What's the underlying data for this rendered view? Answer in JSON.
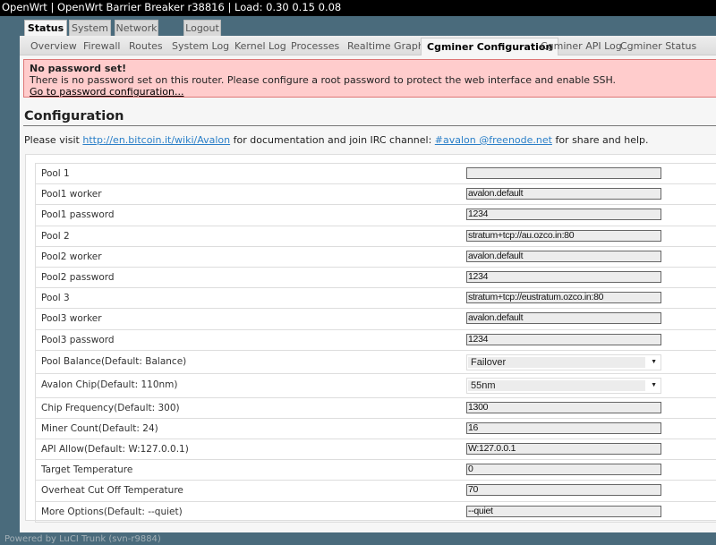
{
  "header": {
    "title": "OpenWrt | OpenWrt Barrier Breaker r38816 | Load: 0.30 0.15 0.08"
  },
  "main_tabs": [
    {
      "label": "Status",
      "active": true
    },
    {
      "label": "System"
    },
    {
      "label": "Network"
    },
    {
      "label": "Logout"
    }
  ],
  "sub_tabs": [
    {
      "label": "Overview"
    },
    {
      "label": "Firewall"
    },
    {
      "label": "Routes"
    },
    {
      "label": "System Log"
    },
    {
      "label": "Kernel Log"
    },
    {
      "label": "Processes"
    },
    {
      "label": "Realtime Graphs"
    },
    {
      "label": "Cgminer Configuration",
      "active": true
    },
    {
      "label": "Cgminer API Log"
    },
    {
      "label": "Cgminer Status"
    }
  ],
  "alert": {
    "title": "No password set!",
    "text": "There is no password set on this router. Please configure a root password to protect the web interface and enable SSH.",
    "link": "Go to password configuration...",
    "color": "#ffcccc"
  },
  "config": {
    "title": "Configuration",
    "intro_pre": "Please visit ",
    "intro_link": "http://en.bitcoin.it/wiki/Avalon",
    "intro_mid": " for documentation and join IRC channel: ",
    "irc_link": "#avalon @freenode.net",
    "intro_post": " for share and help."
  },
  "fields": [
    {
      "label": "Pool 1",
      "value": ""
    },
    {
      "label": "Pool1 worker",
      "value": "avalon.default"
    },
    {
      "label": "Pool1 password",
      "value": "1234"
    },
    {
      "label": "Pool 2",
      "value": "stratum+tcp://au.ozco.in:80"
    },
    {
      "label": "Pool2 worker",
      "value": "avalon.default"
    },
    {
      "label": "Pool2 password",
      "value": "1234"
    },
    {
      "label": "Pool 3",
      "value": "stratum+tcp://eustratum.ozco.in:80"
    },
    {
      "label": "Pool3 worker",
      "value": "avalon.default"
    },
    {
      "label": "Pool3 password",
      "value": "1234"
    },
    {
      "label": "Pool Balance(Default: Balance)",
      "value": "Failover",
      "type": "select"
    },
    {
      "label": "Avalon Chip(Default: 110nm)",
      "value": "55nm",
      "type": "select"
    },
    {
      "label": "Chip Frequency(Default: 300)",
      "value": "1300"
    },
    {
      "label": "Miner Count(Default: 24)",
      "value": "16"
    },
    {
      "label": "API Allow(Default: W:127.0.0.1)",
      "value": "W:127.0.0.1"
    },
    {
      "label": "Target Temperature",
      "value": "0"
    },
    {
      "label": "Overheat Cut Off Temperature",
      "value": "70"
    },
    {
      "label": "More Options(Default: --quiet)",
      "value": "--quiet"
    }
  ],
  "footer": {
    "text": "Powered by LuCI Trunk (svn-r9884)"
  }
}
